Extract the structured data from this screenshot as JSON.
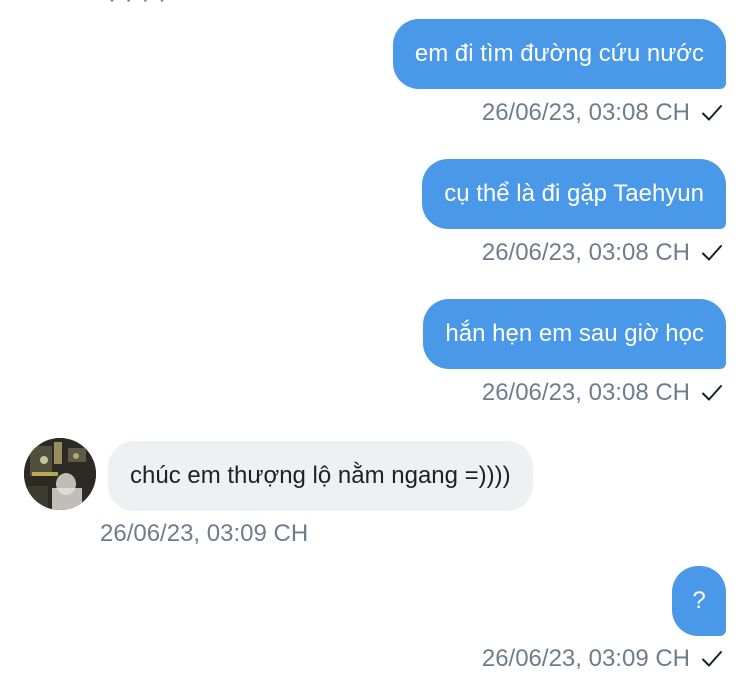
{
  "conversation": {
    "top_fragment": "· · · ·",
    "messages": [
      {
        "direction": "outgoing",
        "text": "em đi tìm đường cứu nước",
        "timestamp": "26/06/23, 03:08 CH",
        "status_icon": "check-icon"
      },
      {
        "direction": "outgoing",
        "text": "cụ thể là đi gặp Taehyun",
        "timestamp": "26/06/23, 03:08 CH",
        "status_icon": "check-icon"
      },
      {
        "direction": "outgoing",
        "text": "hắn hẹn em sau giờ học",
        "timestamp": "26/06/23, 03:08 CH",
        "status_icon": "check-icon"
      },
      {
        "direction": "incoming",
        "text": "chúc em thượng lộ nằm ngang =))))",
        "timestamp": "26/06/23, 03:09 CH",
        "avatar_icon": "avatar-photo"
      },
      {
        "direction": "outgoing",
        "text": "?",
        "timestamp": "26/06/23, 03:09 CH",
        "status_icon": "check-icon"
      }
    ]
  },
  "colors": {
    "outgoing_bubble": "#4a99e9",
    "incoming_bubble": "#eef0f2",
    "timestamp_text": "#6e7d8d"
  }
}
